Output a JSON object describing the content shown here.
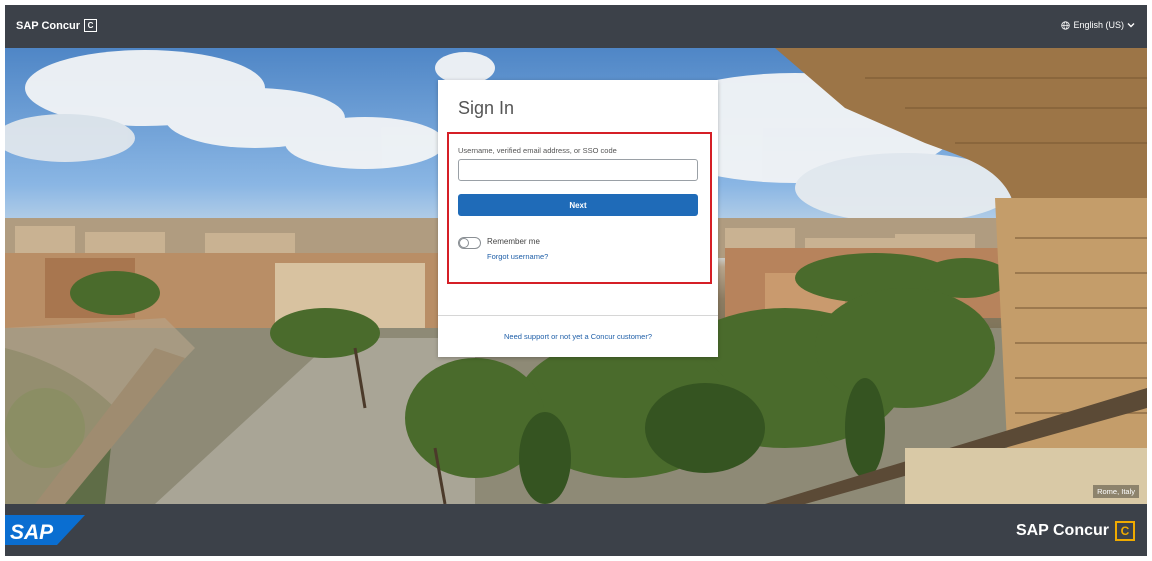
{
  "header": {
    "brand": "SAP Concur",
    "brand_icon": "C",
    "language": "English (US)"
  },
  "login": {
    "title": "Sign In",
    "username_label": "Username, verified email address, or SSO code",
    "username_value": "",
    "next_label": "Next",
    "remember_label": "Remember me",
    "forgot_label": "Forgot username?",
    "support_label": "Need support or not yet a Concur customer?"
  },
  "hero": {
    "caption": "Rome, Italy"
  },
  "footer": {
    "sap_logo": "SAP",
    "concur_logo": "SAP Concur",
    "concur_icon": "C"
  },
  "colors": {
    "bar": "#3c4149",
    "primary": "#1f6bb8",
    "link": "#1f5fa8",
    "highlight": "#d51f26",
    "sap_blue": "#0a6ed1",
    "concur_gold": "#f0ab00"
  }
}
